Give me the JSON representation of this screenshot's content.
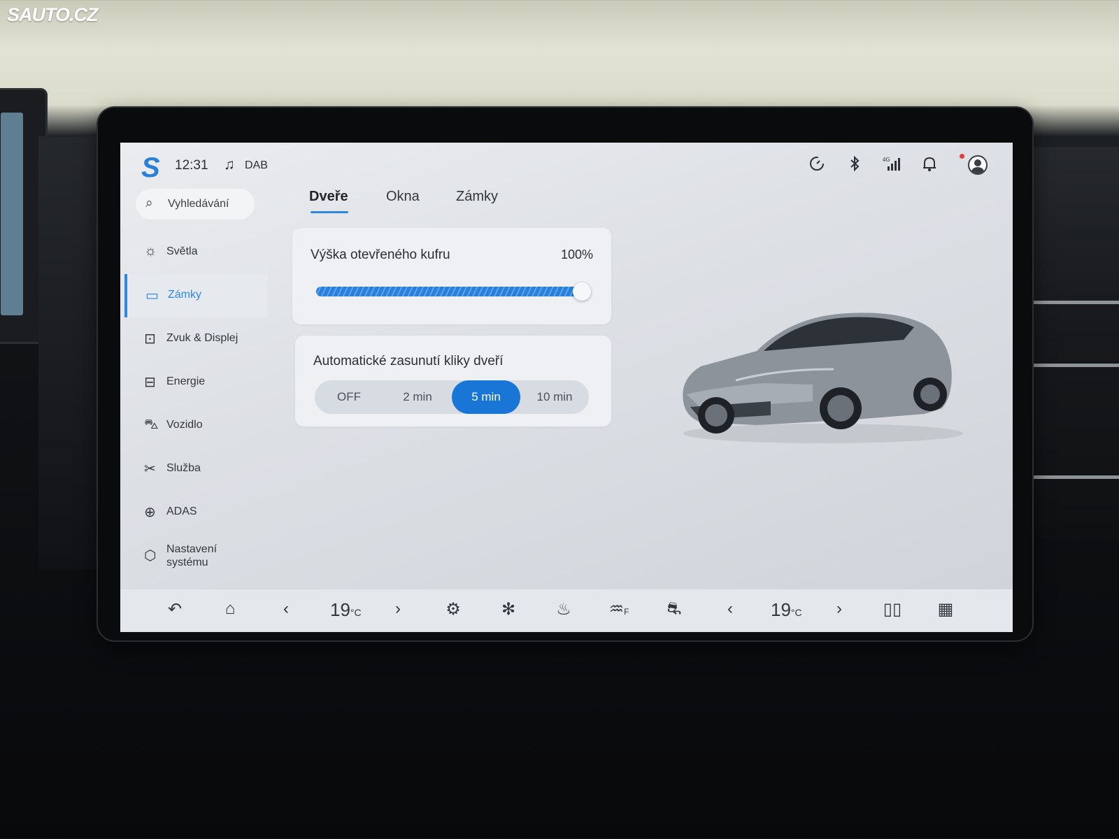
{
  "watermark": "SAUTO.CZ",
  "statusbar": {
    "time": "12:31",
    "source": "DAB",
    "icons": [
      "speed-limit-icon",
      "bluetooth-icon",
      "4g-signal-icon",
      "bell-icon",
      "user-avatar-icon"
    ]
  },
  "sidebar": {
    "search_placeholder": "Vyhledávání",
    "items": [
      {
        "label": "Světla",
        "icon": "light-icon"
      },
      {
        "label": "Zámky",
        "icon": "lock-icon",
        "active": true
      },
      {
        "label": "Zvuk & Displej",
        "icon": "sound-display-icon"
      },
      {
        "label": "Energie",
        "icon": "battery-icon"
      },
      {
        "label": "Vozidlo",
        "icon": "car-icon"
      },
      {
        "label": "Služba",
        "icon": "service-icon"
      },
      {
        "label": "ADAS",
        "icon": "steering-wheel-icon"
      },
      {
        "label": "Nastavení systému",
        "icon": "settings-hex-icon"
      }
    ]
  },
  "tabs": [
    {
      "label": "Dveře",
      "active": true
    },
    {
      "label": "Okna"
    },
    {
      "label": "Zámky"
    }
  ],
  "trunk": {
    "title": "Výška otevřeného kufru",
    "value_text": "100%",
    "level": 1.0
  },
  "handle": {
    "title": "Automatické zasunutí kliky dveří",
    "options": [
      "OFF",
      "2 min",
      "5 min",
      "10 min"
    ],
    "selected": "5 min"
  },
  "bottombar": {
    "temp_left": "19",
    "temp_right": "19",
    "temp_unit": "°C",
    "defrost_label": "F"
  },
  "colors": {
    "accent": "#2f86e3",
    "selected_segment": "#1976d6"
  }
}
